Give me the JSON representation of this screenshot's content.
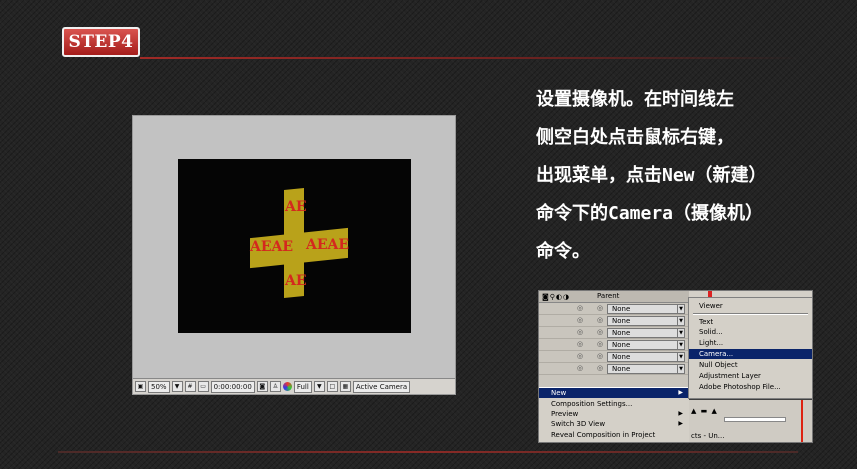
{
  "step_label": "STEP4",
  "viewer": {
    "comp_labels": [
      "AE",
      "AEAE",
      "AEAE",
      "AE"
    ],
    "toolbar": {
      "zoom": "50%",
      "timecode": "0:00:00:00",
      "resolution": "Full",
      "camera_view": "Active Camera"
    }
  },
  "instruction_lines": [
    "设置摄像机。在时间线左",
    "侧空白处点击鼠标右键，",
    "出现菜单，点击New（新建）",
    "命令下的Camera（摄像机）",
    "命令。"
  ],
  "context_menu": {
    "parent_header": "Parent",
    "layer_parent_values": [
      "None",
      "None",
      "None",
      "None",
      "None",
      "None"
    ],
    "left_menu": [
      {
        "label": "New",
        "selected": true,
        "submenu": true
      },
      {
        "label": "Composition Settings...",
        "selected": false,
        "submenu": false
      },
      {
        "label": "Preview",
        "selected": false,
        "submenu": true
      },
      {
        "label": "Switch 3D View",
        "selected": false,
        "submenu": true
      },
      {
        "label": "Reveal Composition in Project",
        "selected": false,
        "submenu": false
      }
    ],
    "new_submenu": [
      {
        "label": "Viewer",
        "selected": false
      },
      {
        "label": "Text",
        "selected": false
      },
      {
        "label": "Solid...",
        "selected": false
      },
      {
        "label": "Light...",
        "selected": false
      },
      {
        "label": "Camera...",
        "selected": true
      },
      {
        "label": "Null Object",
        "selected": false
      },
      {
        "label": "Adjustment Layer",
        "selected": false
      },
      {
        "label": "Adobe Photoshop File...",
        "selected": false
      }
    ],
    "bottom_right_text": "cts - Un..."
  },
  "colors": {
    "badge_red": "#c0302c",
    "menu_highlight": "#0a246a",
    "cross_yellow": "#b9a21a",
    "ae_text_red": "#d4281e"
  }
}
